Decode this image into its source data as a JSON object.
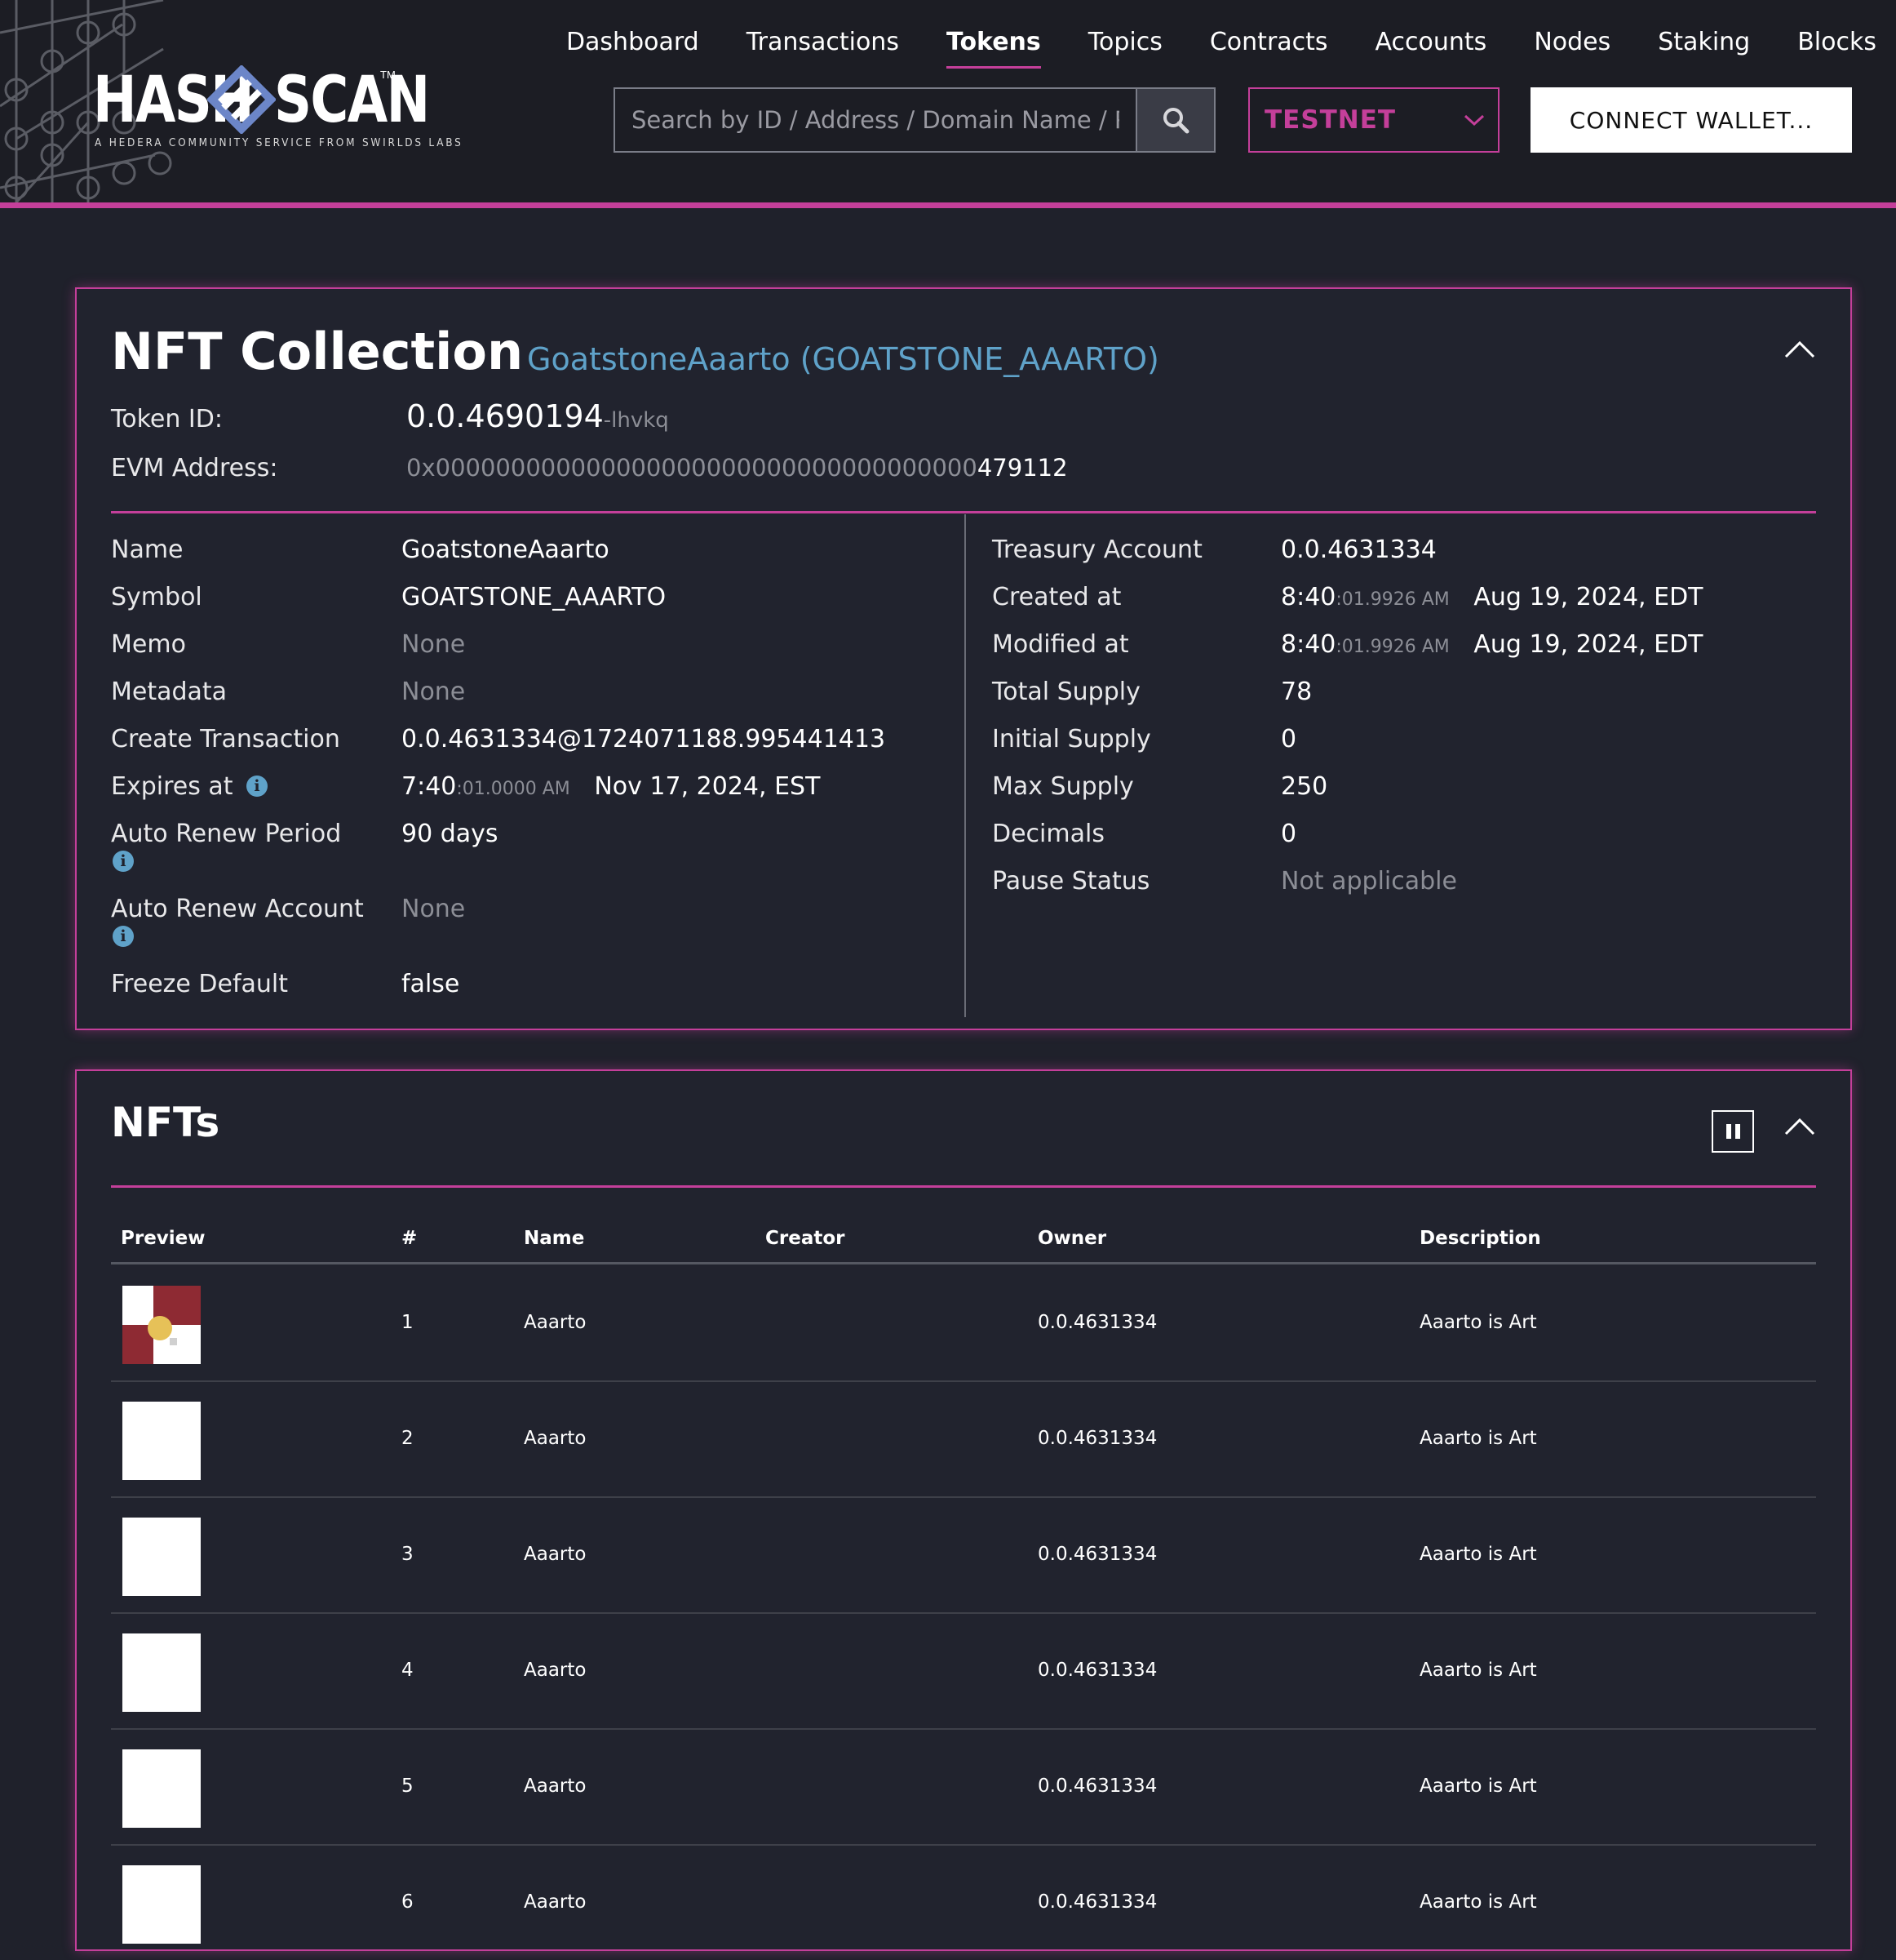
{
  "brand": {
    "word1": "HASH",
    "word2": "SCAN",
    "tm": "TM",
    "tagline": "A HEDERA COMMUNITY SERVICE FROM SWIRLDS LABS"
  },
  "nav": {
    "items": [
      "Dashboard",
      "Transactions",
      "Tokens",
      "Topics",
      "Contracts",
      "Accounts",
      "Nodes",
      "Staking",
      "Blocks"
    ],
    "active": "Tokens"
  },
  "search": {
    "placeholder": "Search by ID / Address / Domain Name / Public Key"
  },
  "network": {
    "selected": "TESTNET"
  },
  "wallet": {
    "connect_label": "CONNECT WALLET..."
  },
  "colors": {
    "accent": "#c43f9a",
    "link": "#5fa2c9",
    "background": "#1f212b"
  },
  "collection": {
    "title": "NFT Collection",
    "subtitle": "GoatstoneAaarto (GOATSTONE_AAARTO)",
    "token_id_label": "Token ID:",
    "token_id": "0.0.4690194",
    "token_id_checksum": "-lhvkq",
    "evm_label": "EVM Address:",
    "evm_prefix": "0x000000000000000000000000000000000000",
    "evm_suffix": "479112",
    "left": {
      "name_label": "Name",
      "name": "GoatstoneAaarto",
      "symbol_label": "Symbol",
      "symbol": "GOATSTONE_AAARTO",
      "memo_label": "Memo",
      "memo": "None",
      "metadata_label": "Metadata",
      "metadata": "None",
      "create_tx_label": "Create Transaction",
      "create_tx": "0.0.4631334@1724071188.995441413",
      "expires_label": "Expires at",
      "expires_time": "7:40",
      "expires_secs": ":01.0000 AM",
      "expires_date": "Nov 17, 2024, EST",
      "renew_period_label": "Auto Renew Period",
      "renew_period": "90 days",
      "renew_account_label": "Auto Renew Account",
      "renew_account": "None",
      "freeze_label": "Freeze Default",
      "freeze": "false"
    },
    "right": {
      "treasury_label": "Treasury Account",
      "treasury": "0.0.4631334",
      "created_label": "Created at",
      "created_time": "8:40",
      "created_secs": ":01.9926 AM",
      "created_date": "Aug 19, 2024, EDT",
      "modified_label": "Modified at",
      "modified_time": "8:40",
      "modified_secs": ":01.9926 AM",
      "modified_date": "Aug 19, 2024, EDT",
      "total_supply_label": "Total Supply",
      "total_supply": "78",
      "initial_supply_label": "Initial Supply",
      "initial_supply": "0",
      "max_supply_label": "Max Supply",
      "max_supply": "250",
      "decimals_label": "Decimals",
      "decimals": "0",
      "pause_label": "Pause Status",
      "pause": "Not applicable"
    }
  },
  "nfts": {
    "title": "NFTs",
    "columns": {
      "preview": "Preview",
      "serial": "#",
      "name": "Name",
      "creator": "Creator",
      "owner": "Owner",
      "description": "Description"
    },
    "rows": [
      {
        "serial": "1",
        "name": "Aaarto",
        "creator": "",
        "owner": "0.0.4631334",
        "description": "Aaarto is Art"
      },
      {
        "serial": "2",
        "name": "Aaarto",
        "creator": "",
        "owner": "0.0.4631334",
        "description": "Aaarto is Art"
      },
      {
        "serial": "3",
        "name": "Aaarto",
        "creator": "",
        "owner": "0.0.4631334",
        "description": "Aaarto is Art"
      },
      {
        "serial": "4",
        "name": "Aaarto",
        "creator": "",
        "owner": "0.0.4631334",
        "description": "Aaarto is Art"
      },
      {
        "serial": "5",
        "name": "Aaarto",
        "creator": "",
        "owner": "0.0.4631334",
        "description": "Aaarto is Art"
      },
      {
        "serial": "6",
        "name": "Aaarto",
        "creator": "",
        "owner": "0.0.4631334",
        "description": "Aaarto is Art"
      }
    ]
  }
}
